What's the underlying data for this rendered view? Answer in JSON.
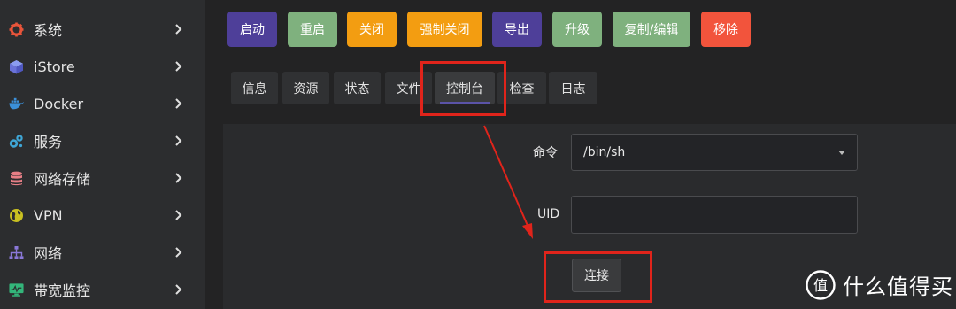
{
  "sidebar": {
    "items": [
      {
        "label": "系统",
        "icon": "gear-icon"
      },
      {
        "label": "iStore",
        "icon": "cube-icon"
      },
      {
        "label": "Docker",
        "icon": "docker-whale-icon"
      },
      {
        "label": "服务",
        "icon": "services-gears-icon"
      },
      {
        "label": "网络存储",
        "icon": "database-icon"
      },
      {
        "label": "VPN",
        "icon": "vpn-globe-icon"
      },
      {
        "label": "网络",
        "icon": "network-tree-icon"
      },
      {
        "label": "带宽监控",
        "icon": "monitor-icon"
      }
    ]
  },
  "toolbar": {
    "buttons": [
      {
        "label": "启动",
        "color": "#4e3f99"
      },
      {
        "label": "重启",
        "color": "#7fb17e"
      },
      {
        "label": "关闭",
        "color": "#f39d11"
      },
      {
        "label": "强制关闭",
        "color": "#f39d11"
      },
      {
        "label": "导出",
        "color": "#4e3f99"
      },
      {
        "label": "升级",
        "color": "#7fb17e"
      },
      {
        "label": "复制/编辑",
        "color": "#7fb17e"
      },
      {
        "label": "移除",
        "color": "#f2543c"
      }
    ]
  },
  "tabs": [
    {
      "label": "信息"
    },
    {
      "label": "资源"
    },
    {
      "label": "状态"
    },
    {
      "label": "文件"
    },
    {
      "label": "控制台"
    },
    {
      "label": "检查"
    },
    {
      "label": "日志"
    }
  ],
  "active_tab": "控制台",
  "form": {
    "command_label": "命令",
    "command_value": "/bin/sh",
    "uid_label": "UID",
    "uid_value": "",
    "connect_label": "连接"
  },
  "watermark": {
    "text": "什么值得买",
    "glyph": "值"
  },
  "colors": {
    "highlight": "#e0241b",
    "accent": "#5b53a8"
  }
}
